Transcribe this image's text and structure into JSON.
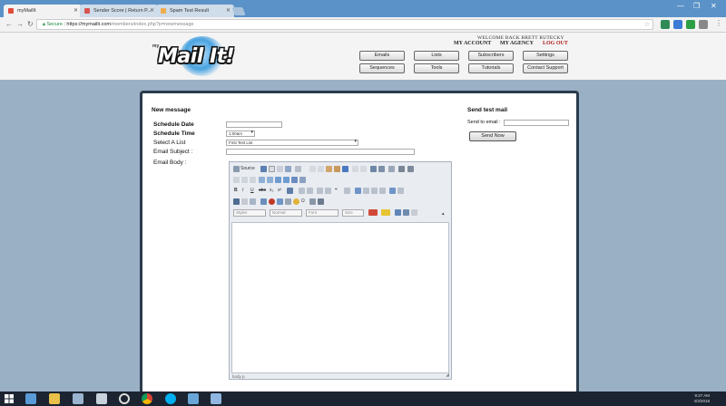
{
  "browser": {
    "tabs": [
      {
        "label": "myMailIt",
        "favicon_color": "#e14b3b",
        "active": true
      },
      {
        "label": "Sender Score | Return P...",
        "favicon_color": "#d9534f",
        "active": false
      },
      {
        "label": "Spam Test Result",
        "favicon_color": "#f0ad4e",
        "active": false
      }
    ],
    "secure_label": "Secure",
    "url_host": "https://mymailit.com",
    "url_path": "/members/index.php?p=newmessage",
    "window_controls": [
      "—",
      "❐",
      "✕"
    ]
  },
  "header": {
    "logo_prefix": "my",
    "logo_text": "Mail It!",
    "welcome": "WELCOME BACK BRETT RUTECKY",
    "links": [
      {
        "label": "MY ACCOUNT",
        "color": "#222222"
      },
      {
        "label": "MY AGENCY",
        "color": "#222222"
      },
      {
        "label": "LOG OUT",
        "color": "#b01c1c"
      }
    ],
    "nav": [
      [
        "Emails",
        "Lists",
        "Subscribers",
        "Settings"
      ],
      [
        "Sequences",
        "Tools",
        "Tutorials",
        "Contact Support"
      ]
    ]
  },
  "form": {
    "heading": "New message",
    "schedule_date_label": "Schedule Date",
    "schedule_date_value": "",
    "schedule_time_label": "Schedule Time",
    "schedule_time_value": "1:00am",
    "list_label": "Select A List",
    "list_value": "First Test List",
    "subject_label": "Email Subject :",
    "subject_value": "",
    "body_label": "Email Body :"
  },
  "test_mail": {
    "heading": "Send test mail",
    "send_to_label": "Send to email :",
    "send_to_value": "",
    "button": "Send Now"
  },
  "editor": {
    "source_label": "Source",
    "styles_placeholder": "Styles",
    "format_placeholder": "Normal",
    "font_placeholder": "Font",
    "size_placeholder": "Size",
    "status_text": "body p"
  },
  "taskbar": {
    "time": "9:27 AM",
    "date": "4/3/2018"
  }
}
